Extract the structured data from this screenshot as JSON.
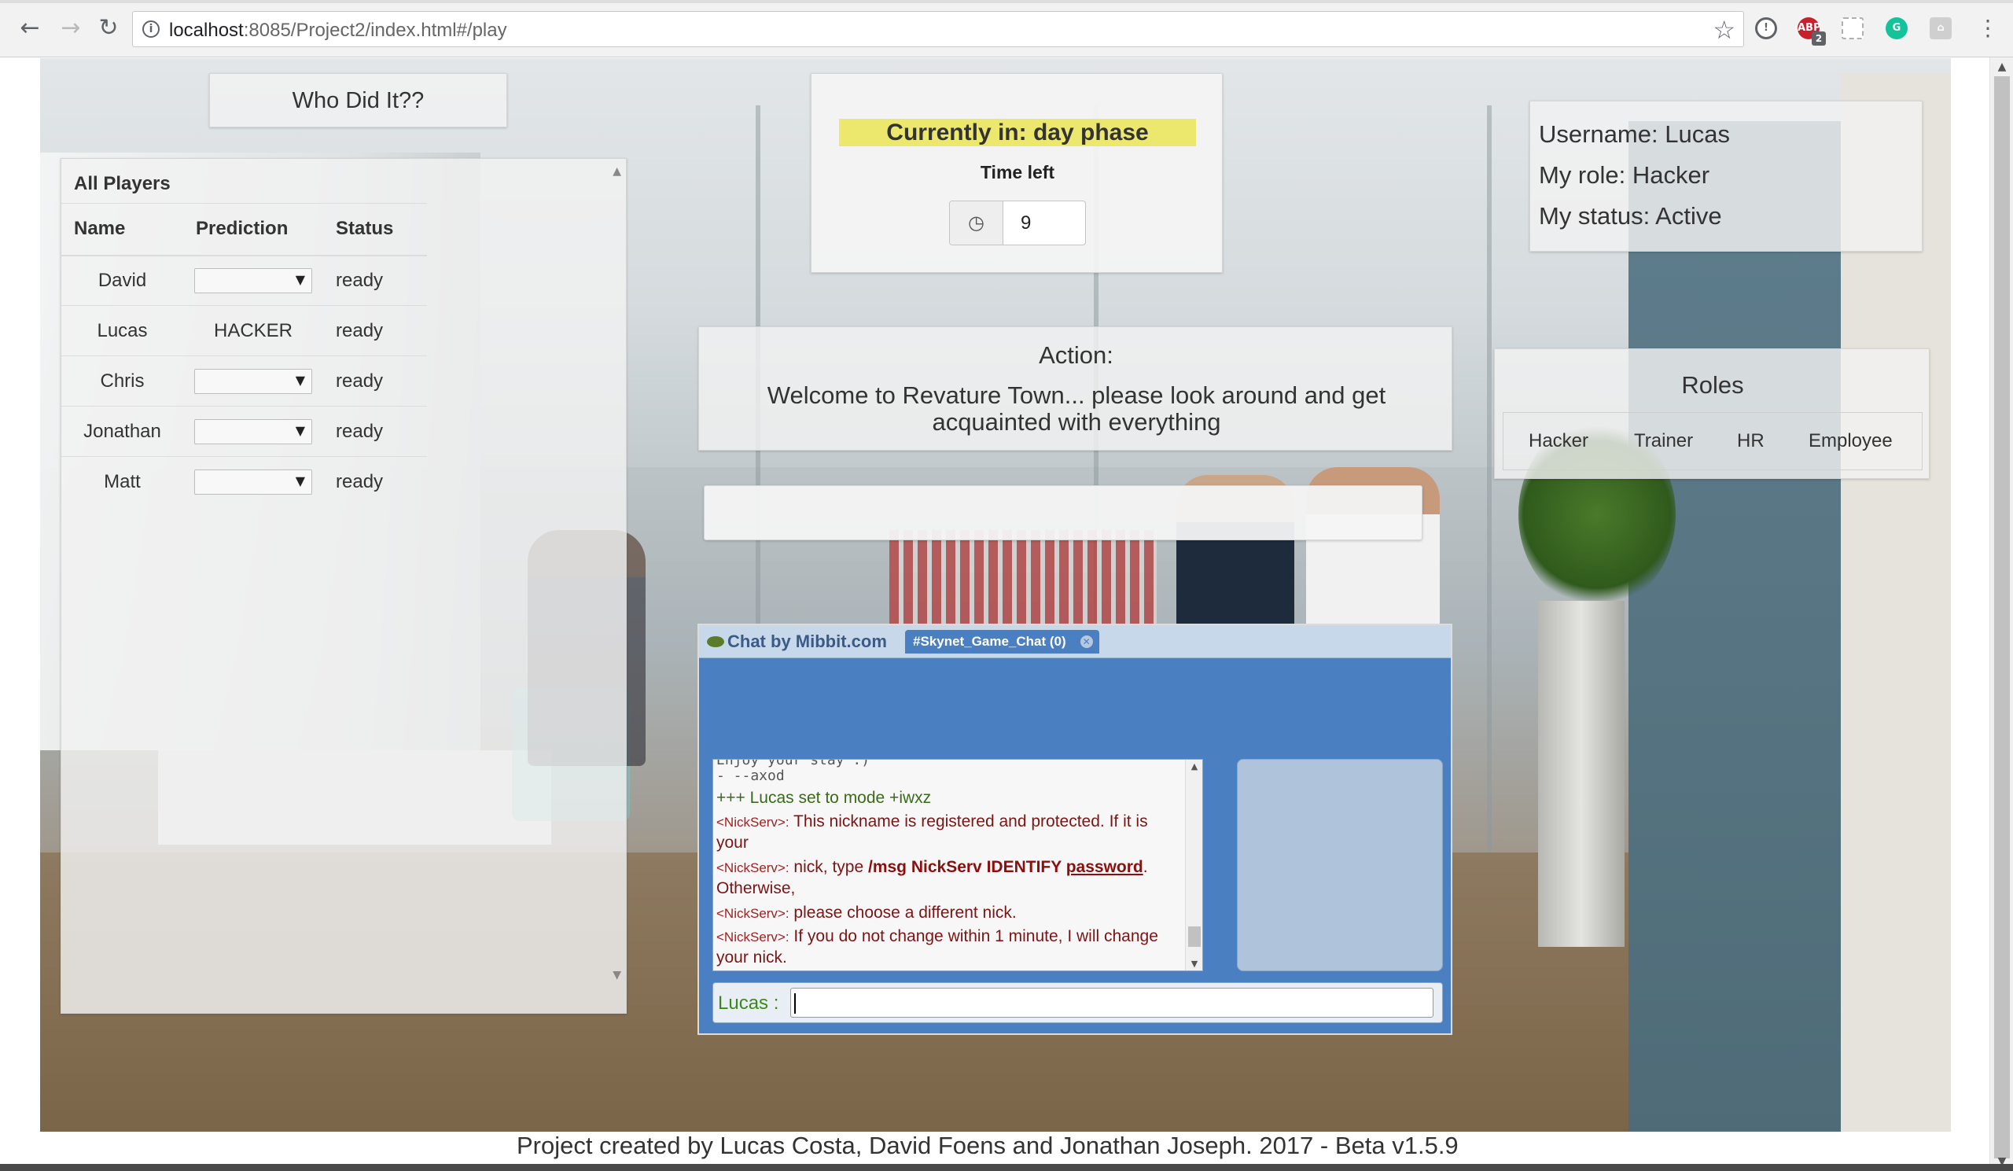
{
  "browser": {
    "url_host": "localhost",
    "url_rest": ":8085/Project2/index.html#/play",
    "extensions": [
      {
        "name": "info-extension-icon",
        "badge": ""
      },
      {
        "name": "adblock-icon",
        "label": "ABP",
        "badge": "2"
      },
      {
        "name": "screenshot-extension-icon",
        "badge": ""
      },
      {
        "name": "grammarly-icon",
        "label": "G",
        "badge": ""
      },
      {
        "name": "puzzle-extension-icon",
        "badge": ""
      }
    ]
  },
  "game": {
    "title": "Who Did It??",
    "players_panel": {
      "title": "All Players",
      "columns": [
        "Name",
        "Prediction",
        "Status"
      ],
      "rows": [
        {
          "name": "David",
          "prediction": "",
          "prediction_type": "select",
          "status": "ready"
        },
        {
          "name": "Lucas",
          "prediction": "HACKER",
          "prediction_type": "text",
          "status": "ready"
        },
        {
          "name": "Chris",
          "prediction": "",
          "prediction_type": "select",
          "status": "ready"
        },
        {
          "name": "Jonathan",
          "prediction": "",
          "prediction_type": "select",
          "status": "ready"
        },
        {
          "name": "Matt",
          "prediction": "",
          "prediction_type": "select",
          "status": "ready"
        }
      ]
    },
    "phase": {
      "banner": "Currently in: day phase",
      "time_left_label": "Time left",
      "time_left_value": "9"
    },
    "user": {
      "username": "Username: Lucas",
      "role": "My role: Hacker",
      "status": "My status: Active"
    },
    "action": {
      "title": "Action:",
      "message": "Welcome to Revature Town... please look around and get acquainted with everything"
    },
    "roles": {
      "title": "Roles",
      "items": [
        "Hacker",
        "Trainer",
        "HR",
        "Employee"
      ]
    }
  },
  "chat": {
    "brand": "Chat by Mibbit.com",
    "tab_label": "#Skynet_Game_Chat (0)",
    "lines": [
      {
        "kind": "sys",
        "text": "  Enjoy your stay :)"
      },
      {
        "kind": "sys",
        "text": "- --axod"
      },
      {
        "kind": "mode",
        "text": "+++ Lucas set to mode +iwxz"
      },
      {
        "kind": "nick",
        "nick": "<NickServ>:",
        "text": " This nickname is registered and protected.  If it is your"
      },
      {
        "kind": "nick",
        "nick": "<NickServ>:",
        "text_before": " nick, type ",
        "bold": "/msg NickServ IDENTIFY ",
        "underline": "password",
        "text_after": ". Otherwise,"
      },
      {
        "kind": "nick",
        "nick": "<NickServ>:",
        "text": " please choose a different nick."
      },
      {
        "kind": "nick",
        "nick": "<NickServ>:",
        "text": " If you do not change within 1 minute, I will change your nick."
      }
    ],
    "input_prefix": "Lucas :",
    "input_value": ""
  },
  "footer": {
    "text": "Project created by Lucas Costa, David Foens and Jonathan Joseph. 2017 - Beta v1.5.9"
  }
}
